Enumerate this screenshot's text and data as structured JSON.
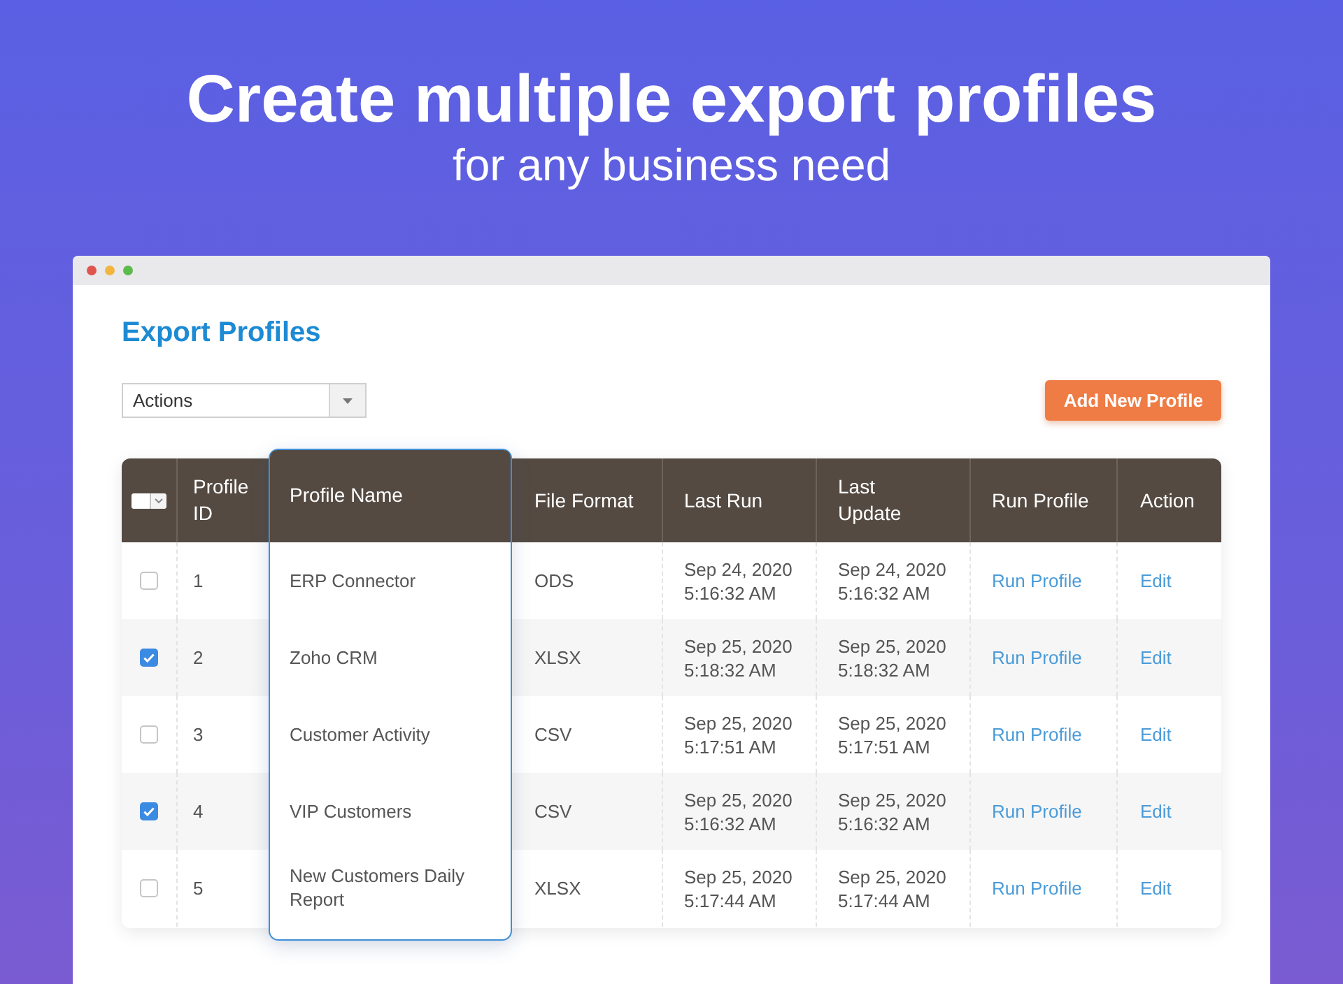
{
  "headline": "Create multiple export profiles",
  "subheadline": "for any business need",
  "window": {
    "page_title": "Export Profiles",
    "actions_select": {
      "value": "Actions"
    },
    "add_button": "Add New Profile",
    "table": {
      "select_all": {
        "checked": false
      },
      "columns": [
        {
          "label": "Profile ID",
          "kind": "text",
          "highlighted": false
        },
        {
          "label": "Profile Name",
          "kind": "text",
          "highlighted": true
        },
        {
          "label": "File Format",
          "kind": "text",
          "highlighted": false
        },
        {
          "label": "Last Run",
          "kind": "text",
          "highlighted": false
        },
        {
          "label": "Last Update",
          "kind": "text",
          "highlighted": false
        },
        {
          "label": "Run Profile",
          "kind": "link",
          "highlighted": false
        },
        {
          "label": "Action",
          "kind": "link",
          "highlighted": false
        }
      ],
      "rows": [
        {
          "checked": false,
          "cells": [
            "1",
            "ERP Connector",
            "ODS",
            "Sep 24, 2020 5:16:32 AM",
            "Sep 24, 2020 5:16:32 AM",
            "Run Profile",
            "Edit"
          ]
        },
        {
          "checked": true,
          "cells": [
            "2",
            "Zoho CRM",
            "XLSX",
            "Sep 25, 2020 5:18:32 AM",
            "Sep 25, 2020 5:18:32 AM",
            "Run Profile",
            "Edit"
          ]
        },
        {
          "checked": false,
          "cells": [
            "3",
            "Customer Activity",
            "CSV",
            "Sep 25, 2020 5:17:51 AM",
            "Sep 25, 2020 5:17:51 AM",
            "Run Profile",
            "Edit"
          ]
        },
        {
          "checked": true,
          "cells": [
            "4",
            "VIP Customers",
            "CSV",
            "Sep 25, 2020 5:16:32 AM",
            "Sep 25, 2020 5:16:32 AM",
            "Run Profile",
            "Edit"
          ]
        },
        {
          "checked": false,
          "cells": [
            "5",
            "New Customers Daily Report",
            "XLSX",
            "Sep 25, 2020 5:17:44 AM",
            "Sep 25, 2020 5:17:44 AM",
            "Run Profile",
            "Edit"
          ]
        }
      ]
    }
  }
}
